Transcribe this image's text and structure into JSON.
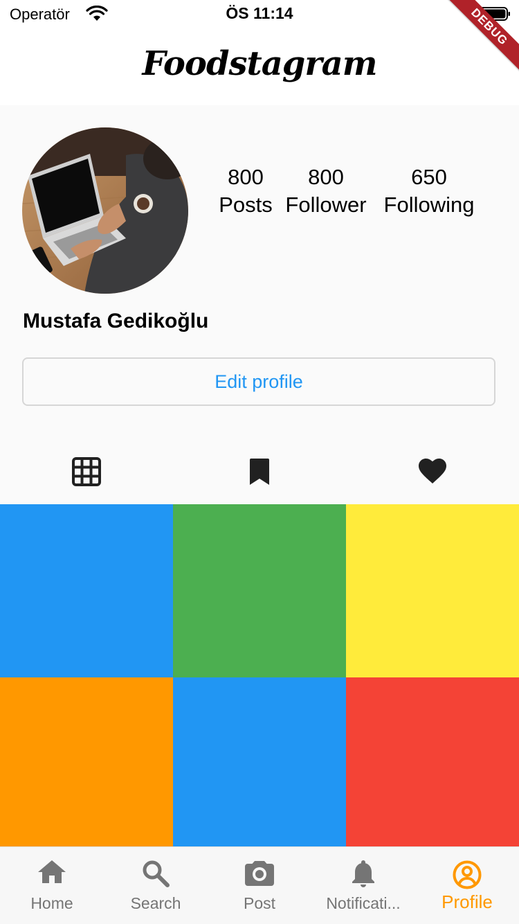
{
  "status_bar": {
    "carrier": "Operatör",
    "time": "ÖS 11:14"
  },
  "debug_banner": "DEBUG",
  "app_bar": {
    "title": "Foodstagram"
  },
  "profile": {
    "avatar_icon": "laptop-photo",
    "name": "Mustafa Gedikoğlu",
    "stats": [
      {
        "value": "800",
        "label": "Posts"
      },
      {
        "value": "800",
        "label": "Follower"
      },
      {
        "value": "650",
        "label": "Following"
      }
    ],
    "edit_button_label": "Edit profile"
  },
  "tabs": [
    {
      "icon": "grid-icon",
      "selected": true
    },
    {
      "icon": "bookmark-icon",
      "selected": false
    },
    {
      "icon": "heart-icon",
      "selected": false
    }
  ],
  "posts": [
    {
      "color": "#2196f3"
    },
    {
      "color": "#4caf50"
    },
    {
      "color": "#ffeb3b"
    },
    {
      "color": "#ff9800"
    },
    {
      "color": "#2196f3"
    },
    {
      "color": "#f44336"
    }
  ],
  "bottom_nav": {
    "active_color": "#ff9800",
    "inactive_color": "#757575",
    "items": [
      {
        "label": "Home",
        "icon": "home-icon",
        "active": false
      },
      {
        "label": "Search",
        "icon": "search-icon",
        "active": false
      },
      {
        "label": "Post",
        "icon": "camera-icon",
        "active": false
      },
      {
        "label": "Notificati...",
        "icon": "bell-icon",
        "active": false
      },
      {
        "label": "Profile",
        "icon": "account-circle-icon",
        "active": true
      }
    ]
  }
}
